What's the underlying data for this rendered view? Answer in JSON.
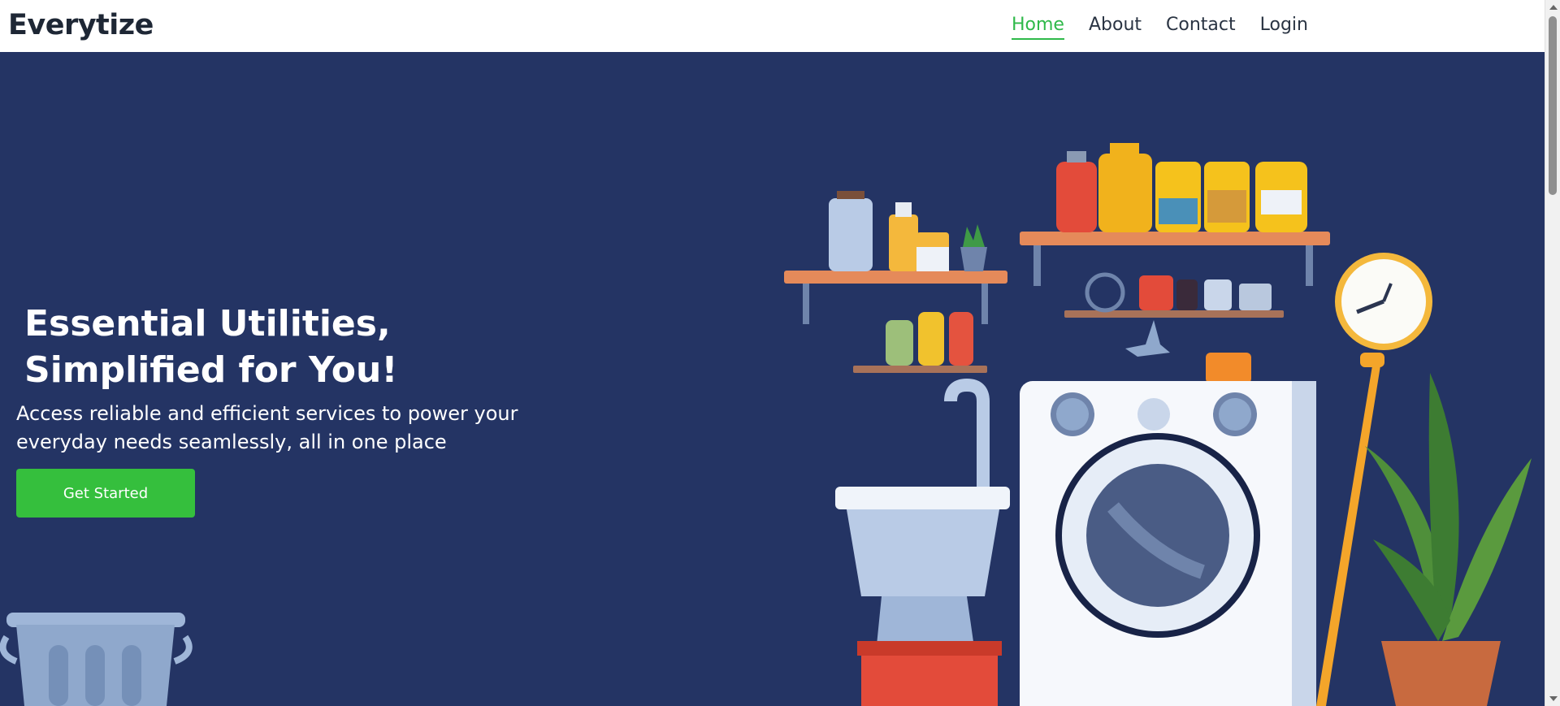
{
  "header": {
    "brand": "Everytize",
    "nav": [
      {
        "label": "Home",
        "active": true
      },
      {
        "label": "About",
        "active": false
      },
      {
        "label": "Contact",
        "active": false
      },
      {
        "label": "Login",
        "active": false
      }
    ]
  },
  "hero": {
    "title": "Essential Utilities, Simplified for You!",
    "subtitle": "Access reliable and efficient services to power your everyday needs seamlessly, all in one place",
    "cta_label": "Get Started",
    "illustration": "laundry-room-illustration"
  },
  "colors": {
    "accent": "#2fb94a",
    "button": "#35bf3d",
    "hero_bg": "#243464",
    "brand_text": "#1e2735"
  }
}
